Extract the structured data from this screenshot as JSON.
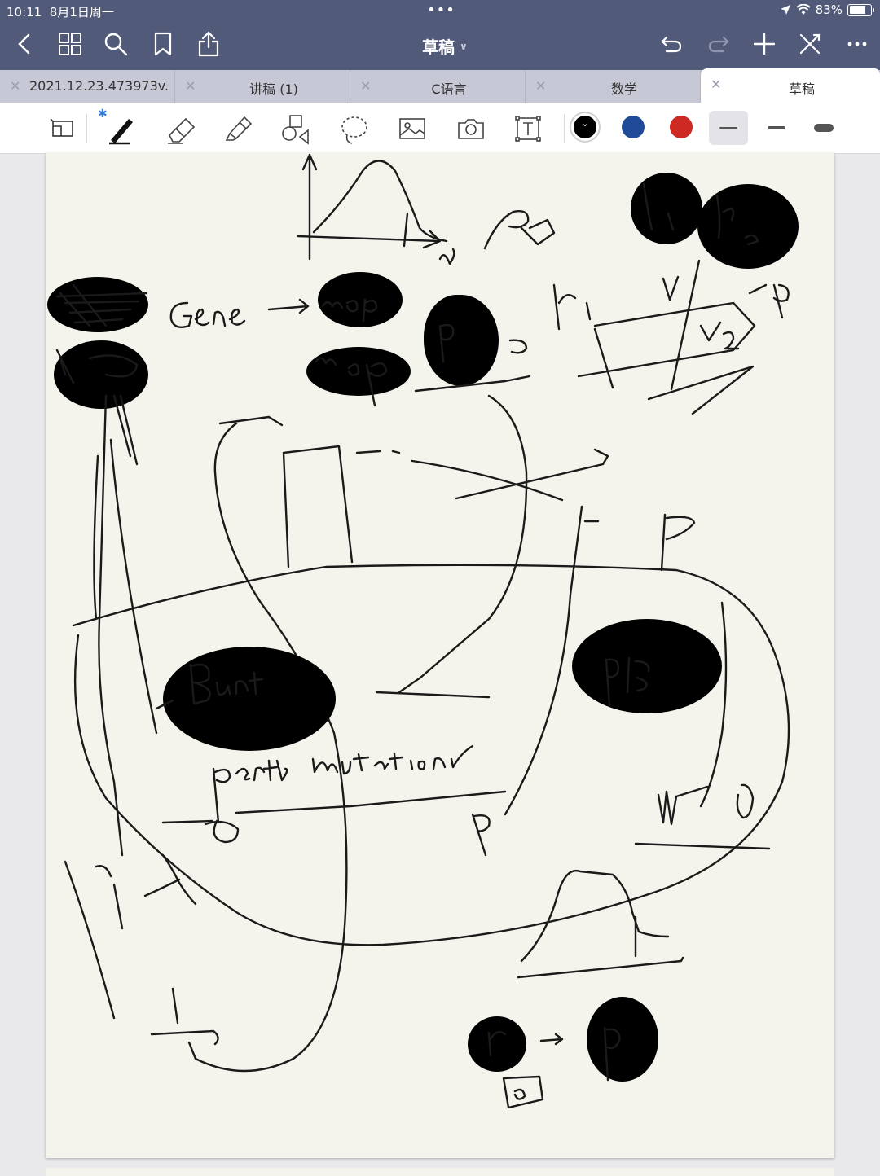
{
  "status_bar": {
    "time": "10:11",
    "date": "8月1日周一",
    "battery": "83%",
    "battery_level": 0.83
  },
  "nav": {
    "title": "草稿",
    "icons": [
      "back-icon",
      "grid-icon",
      "search-icon",
      "bookmark-icon",
      "share-icon",
      "undo-icon",
      "redo-icon",
      "add-icon",
      "close-pen-icon",
      "more-icon"
    ]
  },
  "tabs": [
    {
      "label": "2021.12.23.473973v...",
      "active": false
    },
    {
      "label": "讲稿 (1)",
      "active": false
    },
    {
      "label": "C语言",
      "active": false
    },
    {
      "label": "数学",
      "active": false
    },
    {
      "label": "草稿",
      "active": true
    }
  ],
  "toolbar": {
    "tools": [
      "page-layout-icon",
      "pen-icon",
      "eraser-icon",
      "highlighter-icon",
      "shapes-icon",
      "lasso-icon",
      "image-icon",
      "camera-icon",
      "text-icon"
    ],
    "selected_tool": "pen-icon",
    "colors": [
      "#000000",
      "#1f4b99",
      "#cc2a22"
    ],
    "selected_color": "#000000",
    "stroke_widths": [
      "thin",
      "medium",
      "thick"
    ],
    "selected_stroke": "thin"
  },
  "canvas": {
    "handwriting": [
      "Gene",
      "map",
      "map",
      "P.",
      "P值",
      "P",
      "p",
      "r1",
      "r2",
      "V1",
      "V2",
      "Bunt",
      "pertb mutation",
      "P",
      "r",
      "P.",
      "P",
      "0"
    ]
  }
}
